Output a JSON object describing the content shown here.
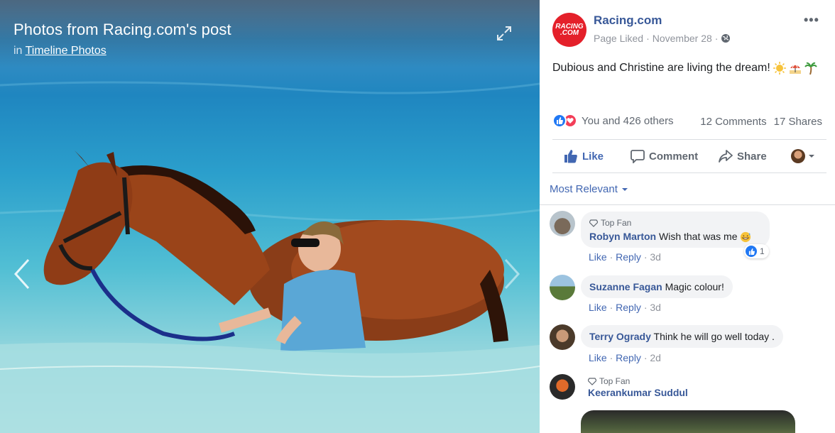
{
  "photo": {
    "title": "Photos from Racing.com's post",
    "sub_prefix": "in",
    "sub_link": "Timeline Photos"
  },
  "post": {
    "page_name": "Racing.com",
    "page_logo_text": "RACING .COM",
    "page_status": "Page Liked",
    "date": "November 28",
    "text": "Dubious and Christine are living the dream!",
    "emojis": [
      "sun-emoji",
      "beach-umbrella-emoji",
      "palm-tree-emoji"
    ],
    "reactions_text": "You and 426 others",
    "comments_count": "12 Comments",
    "shares_count": "17 Shares"
  },
  "actions": {
    "like": "Like",
    "comment": "Comment",
    "share": "Share"
  },
  "sort_label": "Most Relevant",
  "comments": [
    {
      "badge": "Top Fan",
      "name": "Robyn Marton",
      "text": "Wish that was me",
      "like": "Like",
      "reply": "Reply",
      "time": "3d",
      "reaction_count": "1"
    },
    {
      "badge": "",
      "name": "Suzanne Fagan",
      "text": "Magic colour!",
      "like": "Like",
      "reply": "Reply",
      "time": "3d"
    },
    {
      "badge": "",
      "name": "Terry Ogrady",
      "text": "Think he will go well today .",
      "like": "Like",
      "reply": "Reply",
      "time": "2d"
    },
    {
      "badge": "Top Fan",
      "name": "Keerankumar Suddul",
      "text": ""
    }
  ],
  "colors": {
    "accent": "#4267b2",
    "name_blue": "#385898",
    "logo_red": "#e4202a",
    "meta_gray": "#90949c"
  }
}
